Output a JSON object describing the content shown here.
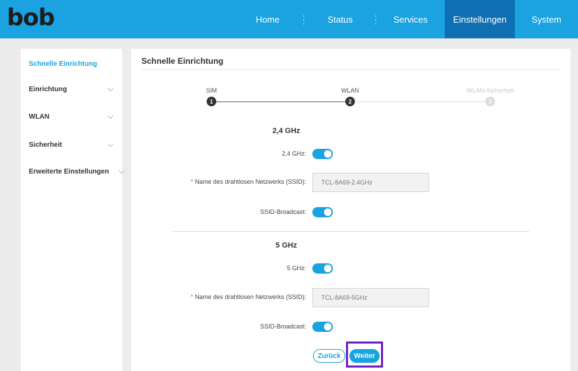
{
  "brand": {
    "logo": "bob"
  },
  "nav": [
    {
      "label": "Home"
    },
    {
      "label": "Status"
    },
    {
      "label": "Services"
    },
    {
      "label": "Einstellungen",
      "active": true
    },
    {
      "label": "System"
    }
  ],
  "sidebar": {
    "items": [
      {
        "label": "Schnelle Einrichtung",
        "active": true
      },
      {
        "label": "Einrichtung"
      },
      {
        "label": "WLAN"
      },
      {
        "label": "Sicherheit"
      },
      {
        "label": "Erweiterte Einstellungen"
      }
    ]
  },
  "main": {
    "title": "Schnelle Einrichtung",
    "steps": [
      {
        "label": "SIM",
        "number": "1"
      },
      {
        "label": "WLAN",
        "number": "2"
      },
      {
        "label": "WLAN-Sicherheit",
        "number": "3"
      }
    ],
    "band24": {
      "title": "2,4 GHz",
      "toggle_label": "2,4 GHz:",
      "toggle_on": true,
      "ssid_required_mark": "*",
      "ssid_label": "Name des drahtlosen Netzwerks (SSID):",
      "ssid_value": "TCL-8A69-2.4GHz",
      "broadcast_label": "SSID-Broadcast:",
      "broadcast_on": true
    },
    "band5": {
      "title": "5 GHz",
      "toggle_label": "5 GHz:",
      "toggle_on": true,
      "ssid_required_mark": "*",
      "ssid_label": "Name des drahtlosen Netzwerks (SSID):",
      "ssid_value": "TCL-8A69-5GHz",
      "broadcast_label": "SSID-Broadcast:",
      "broadcast_on": true
    },
    "buttons": {
      "back": "Zurück",
      "next": "Weiter"
    }
  },
  "colors": {
    "accent": "#1aa3e0",
    "nav_active": "#0e6fb3",
    "highlight": "#6a1fc4"
  }
}
